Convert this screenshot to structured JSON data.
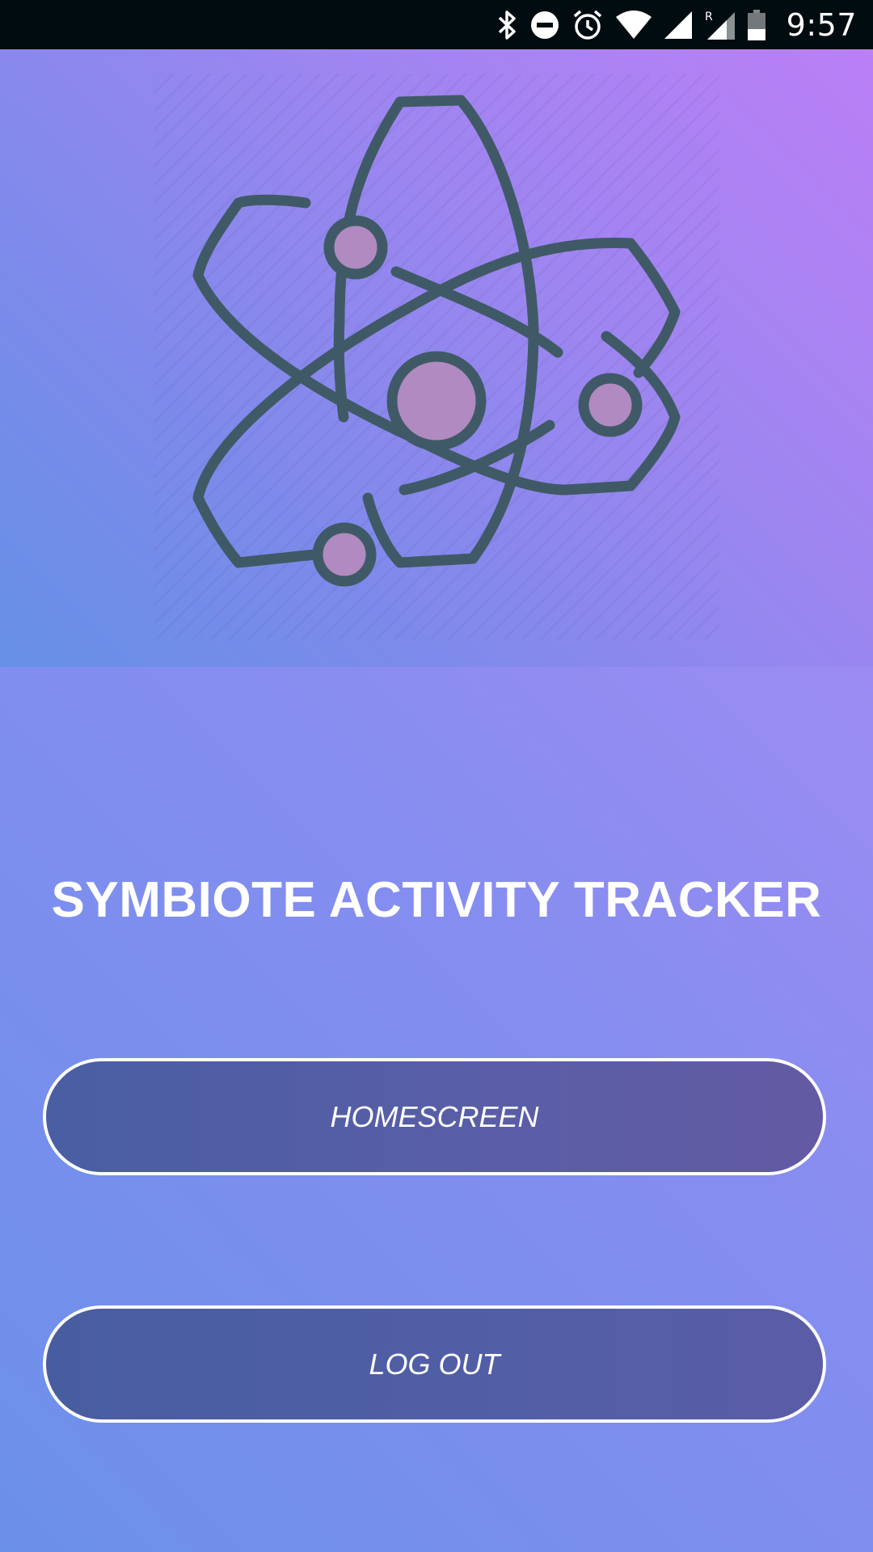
{
  "status_bar": {
    "time": "9:57",
    "icons": [
      "bluetooth-icon",
      "do-not-disturb-icon",
      "alarm-icon",
      "wifi-icon",
      "signal-icon",
      "roaming-signal-icon",
      "battery-icon"
    ],
    "roaming_label": "R"
  },
  "hero": {
    "icon": "atom-icon",
    "colors": {
      "stroke": "#3f5a66",
      "fill": "#b08ac0"
    }
  },
  "app": {
    "title": "SYMBIOTE ACTIVITY TRACKER"
  },
  "buttons": {
    "homescreen_label": "HOMESCREEN",
    "logout_label": "LOG OUT"
  },
  "colors": {
    "gradient_top_right": "#b57ff5",
    "gradient_bottom_left": "#6b90ea",
    "button_fill": "#525ea6",
    "button_border": "#ffffff",
    "text": "#ffffff"
  }
}
